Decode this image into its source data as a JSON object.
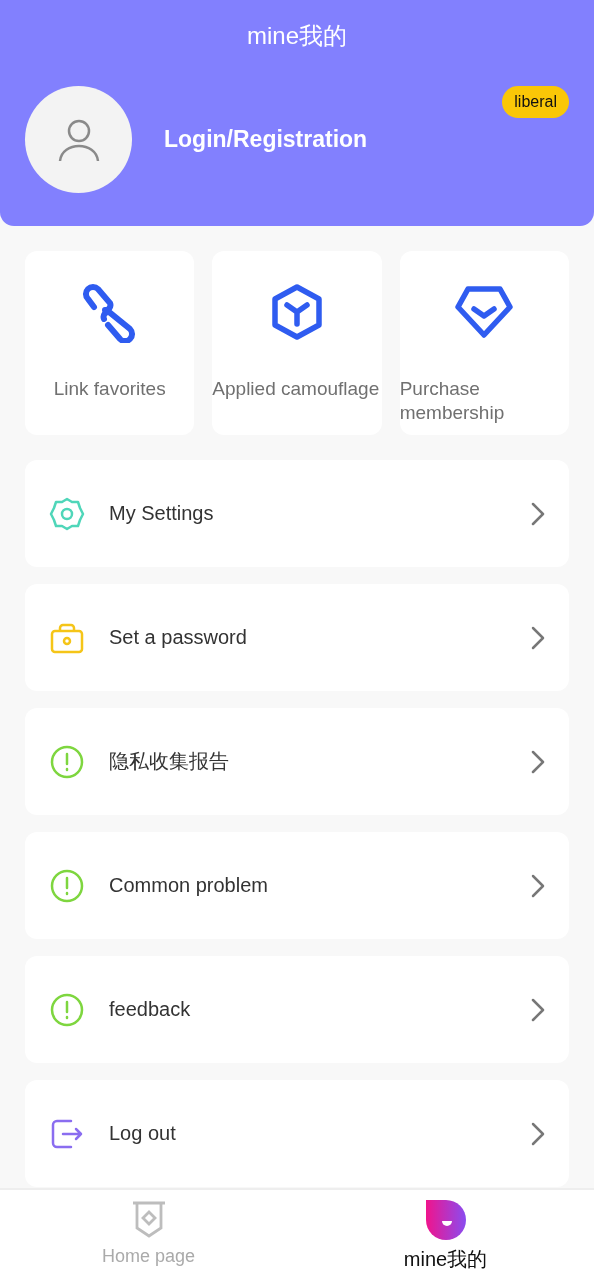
{
  "header": {
    "title": "mine我的",
    "login": "Login/Registration",
    "badge": "liberal"
  },
  "tiles": [
    {
      "kind": "link",
      "label": "Link favorites"
    },
    {
      "kind": "hex",
      "label": "Applied camouflage"
    },
    {
      "kind": "gem",
      "label": "Purchase membership"
    }
  ],
  "menu": [
    {
      "kind": "gear",
      "label": "My Settings"
    },
    {
      "kind": "lock",
      "label": "Set a password"
    },
    {
      "kind": "alert",
      "label": "隐私收集报告"
    },
    {
      "kind": "alert",
      "label": "Common problem"
    },
    {
      "kind": "alert",
      "label": "feedback"
    },
    {
      "kind": "logout",
      "label": "Log out"
    }
  ],
  "tabs": [
    {
      "kind": "home",
      "label": "Home page",
      "selected": false
    },
    {
      "kind": "mine",
      "label": "mine我的",
      "selected": true
    }
  ]
}
